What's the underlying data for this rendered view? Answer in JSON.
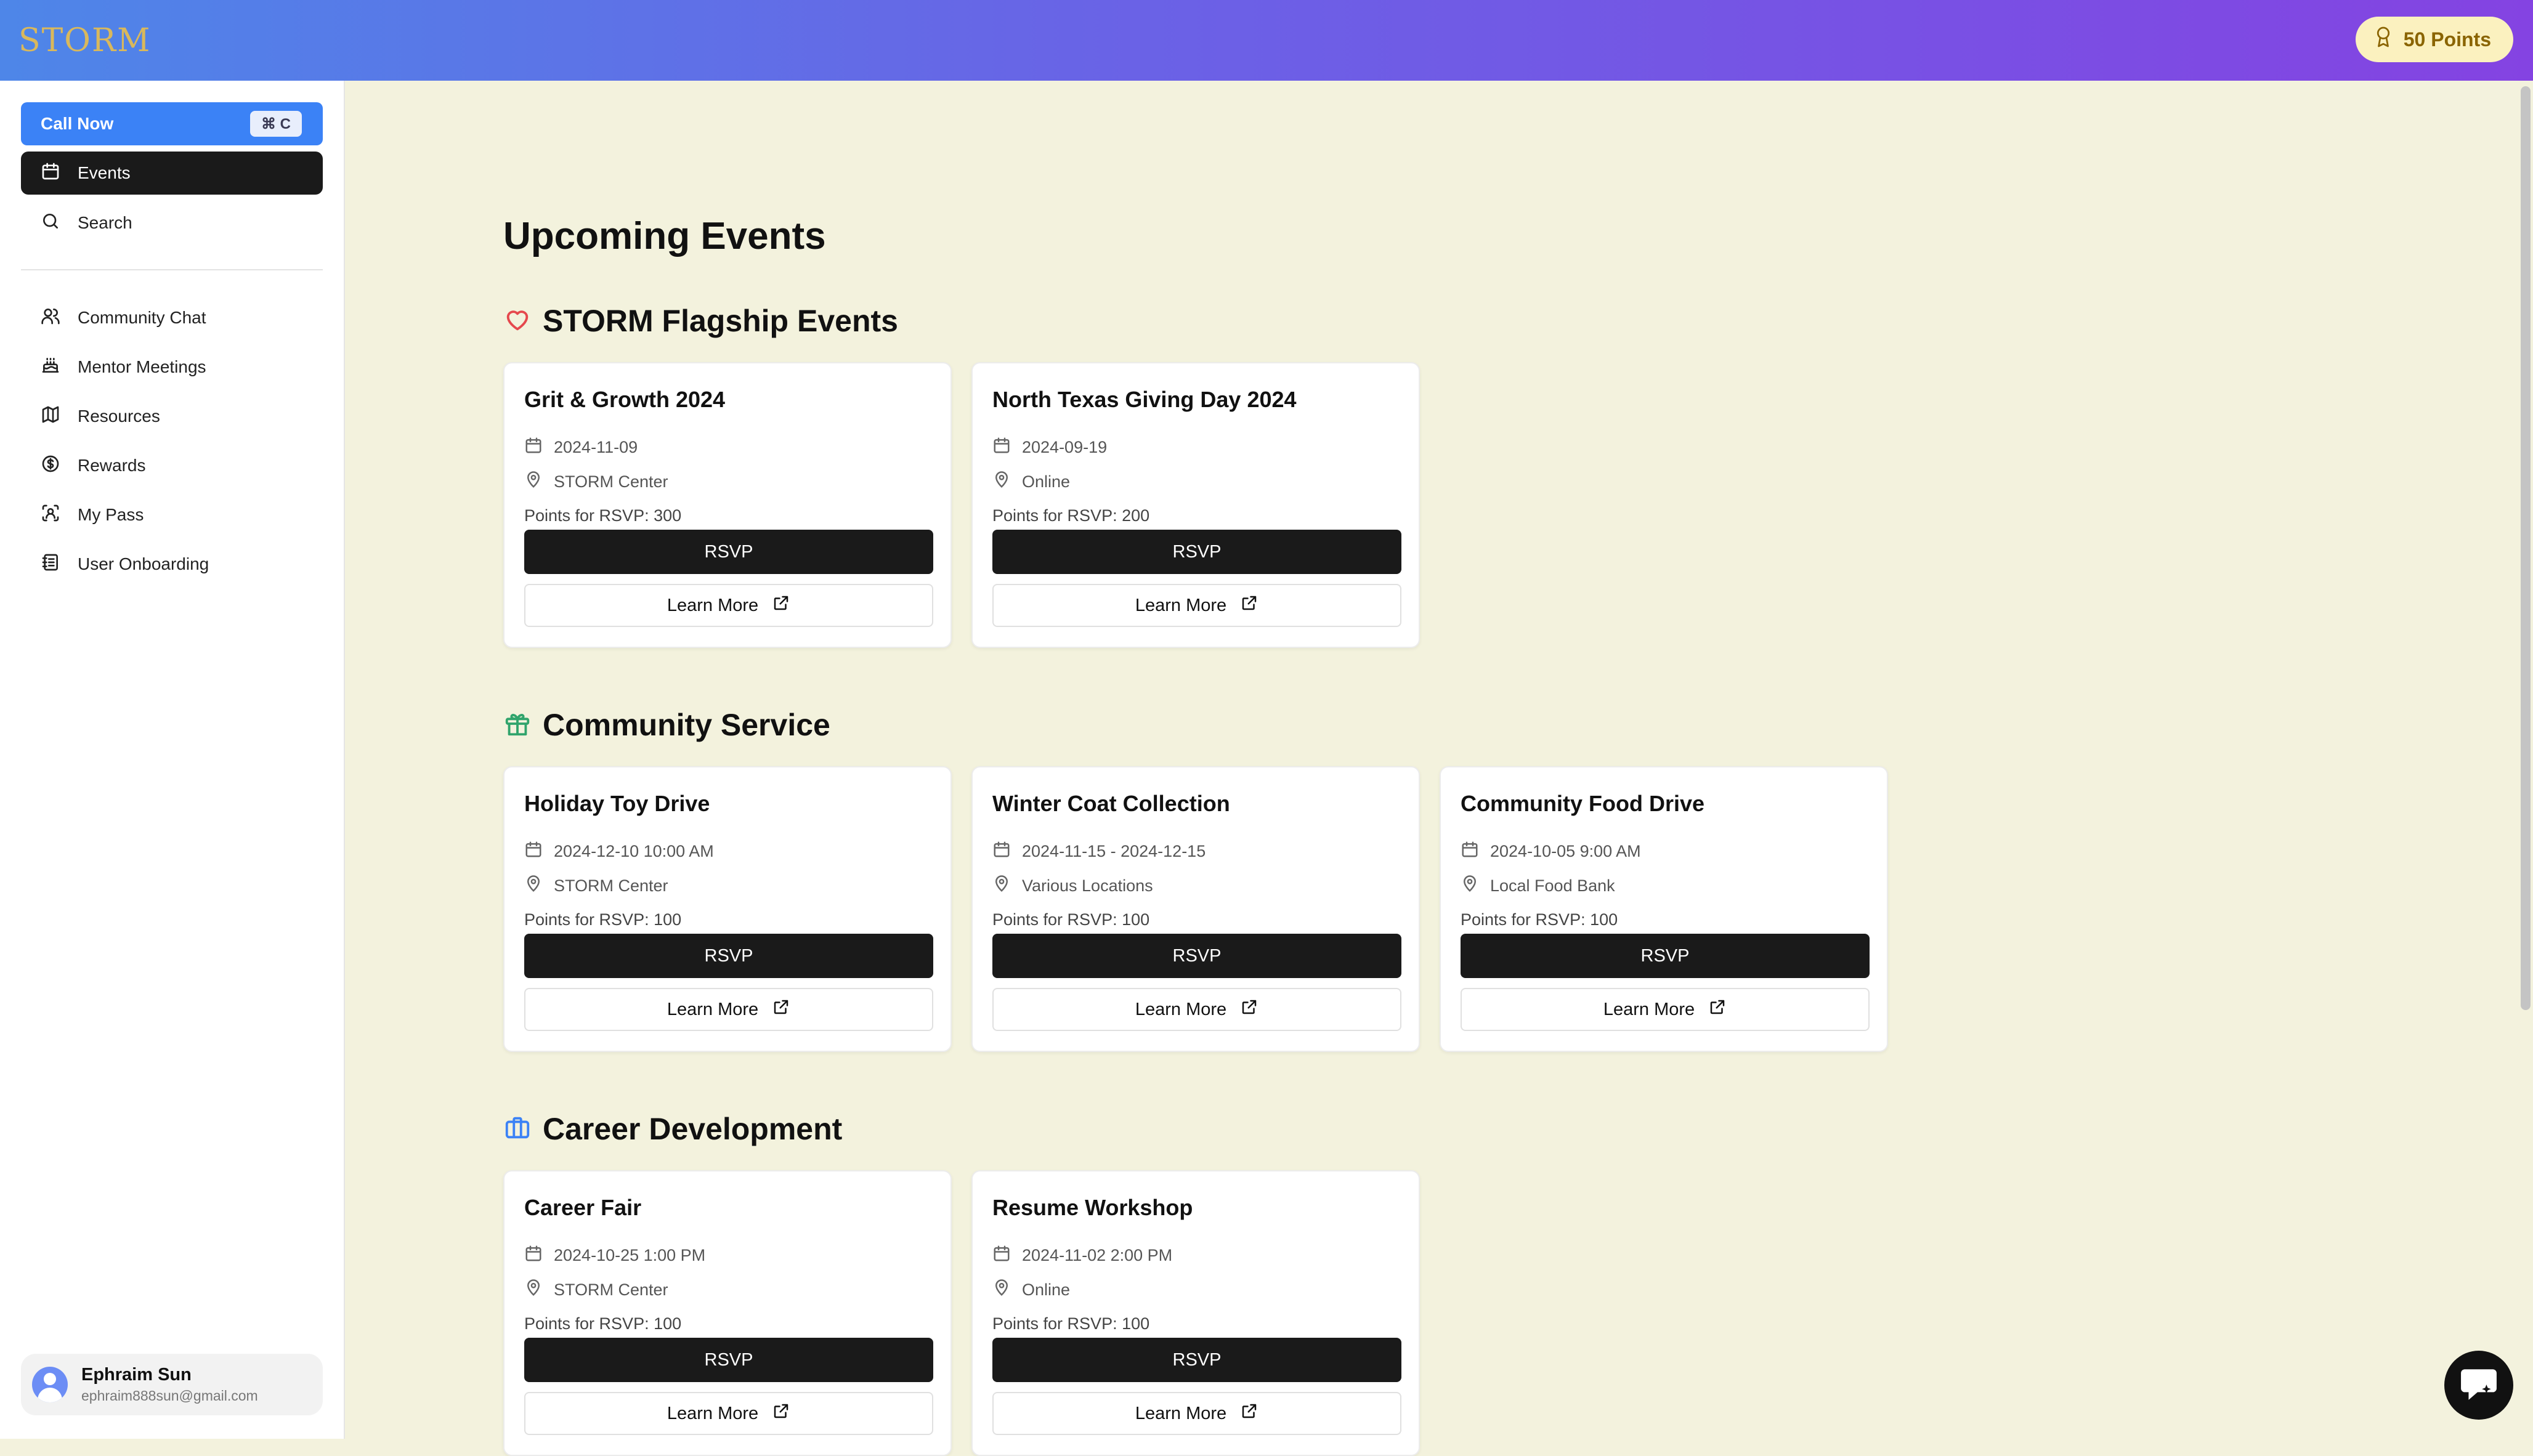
{
  "header": {
    "logo_text": "STORM",
    "points": "50 Points"
  },
  "sidebar": {
    "call_now": {
      "label": "Call Now",
      "shortcut": "⌘ C"
    },
    "primary": [
      {
        "label": "Events",
        "icon": "calendar-icon",
        "active": true
      },
      {
        "label": "Search",
        "icon": "search-icon"
      }
    ],
    "secondary": [
      {
        "label": "Community Chat",
        "icon": "users-icon"
      },
      {
        "label": "Mentor Meetings",
        "icon": "cake-icon"
      },
      {
        "label": "Resources",
        "icon": "map-icon"
      },
      {
        "label": "Rewards",
        "icon": "dollar-circle-icon"
      },
      {
        "label": "My Pass",
        "icon": "scan-face-icon"
      },
      {
        "label": "User Onboarding",
        "icon": "notebook-icon"
      }
    ],
    "user": {
      "name": "Ephraim Sun",
      "email": "ephraim888sun@gmail.com"
    }
  },
  "main": {
    "title": "Upcoming Events",
    "sections": [
      {
        "title": "STORM Flagship Events",
        "icon": "heart-icon",
        "color": "#e5484d",
        "events": [
          {
            "title": "Grit & Growth 2024",
            "date": "2024-11-09",
            "location": "STORM Center",
            "points": "Points for RSVP: 300",
            "rsvp": "RSVP",
            "learn": "Learn More"
          },
          {
            "title": "North Texas Giving Day 2024",
            "date": "2024-09-19",
            "location": "Online",
            "points": "Points for RSVP: 200",
            "rsvp": "RSVP",
            "learn": "Learn More"
          }
        ]
      },
      {
        "title": "Community Service",
        "icon": "gift-icon",
        "color": "#30a46c",
        "events": [
          {
            "title": "Holiday Toy Drive",
            "date": "2024-12-10 10:00 AM",
            "location": "STORM Center",
            "points": "Points for RSVP: 100",
            "rsvp": "RSVP",
            "learn": "Learn More"
          },
          {
            "title": "Winter Coat Collection",
            "date": "2024-11-15 - 2024-12-15",
            "location": "Various Locations",
            "points": "Points for RSVP: 100",
            "rsvp": "RSVP",
            "learn": "Learn More"
          },
          {
            "title": "Community Food Drive",
            "date": "2024-10-05 9:00 AM",
            "location": "Local Food Bank",
            "points": "Points for RSVP: 100",
            "rsvp": "RSVP",
            "learn": "Learn More"
          }
        ]
      },
      {
        "title": "Career Development",
        "icon": "briefcase-icon",
        "color": "#3b82f6",
        "events": [
          {
            "title": "Career Fair",
            "date": "2024-10-25 1:00 PM",
            "location": "STORM Center",
            "points": "Points for RSVP: 100",
            "rsvp": "RSVP",
            "learn": "Learn More"
          },
          {
            "title": "Resume Workshop",
            "date": "2024-11-02 2:00 PM",
            "location": "Online",
            "points": "Points for RSVP: 100",
            "rsvp": "RSVP",
            "learn": "Learn More"
          }
        ]
      }
    ]
  },
  "chat_button": {
    "icon": "chat-bubble-icon"
  }
}
